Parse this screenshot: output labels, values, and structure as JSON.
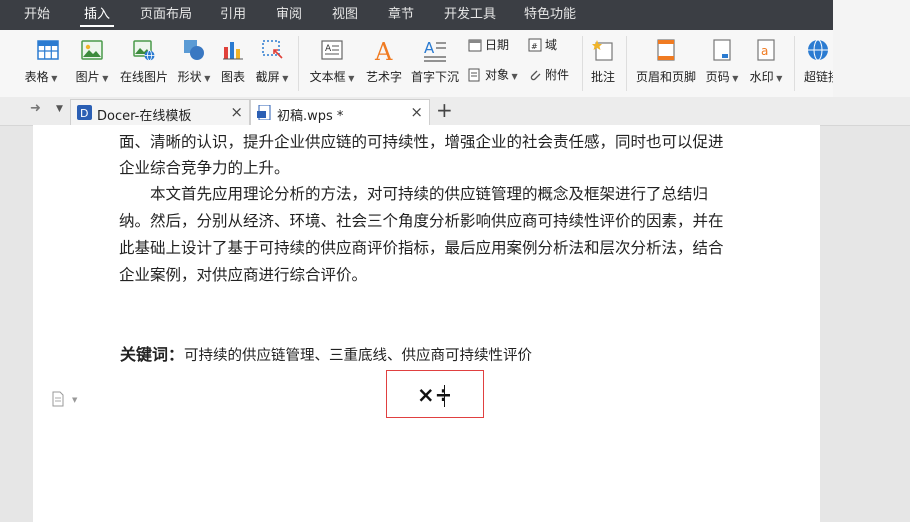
{
  "menu": {
    "tabs": [
      "开始",
      "插入",
      "页面布局",
      "引用",
      "审阅",
      "视图",
      "章节",
      "开发工具",
      "特色功能"
    ],
    "active_tab": "插入"
  },
  "ribbon": {
    "table": "表格",
    "picture": "图片",
    "online_picture": "在线图片",
    "shape": "形状",
    "chart": "图表",
    "screenshot": "截屏",
    "textbox": "文本框",
    "wordart": "艺术字",
    "dropcap": "首字下沉",
    "date": "日期",
    "object": "对象",
    "field": "域",
    "attachment": "附件",
    "comment": "批注",
    "header_footer": "页眉和页脚",
    "page_number": "页码",
    "watermark": "水印",
    "hyperlink": "超链接"
  },
  "doc_tabs": {
    "tab1": "Docer-在线模板",
    "tab2": "初稿.wps *",
    "close": "×",
    "add": "+"
  },
  "document": {
    "para1": [
      "面、清晰的认识，提升企业供应链的可持续性，增强企业的社会责任感，同时也可以促进",
      "企业综合竞争力的上升。"
    ],
    "para2": [
      "本文首先应用理论分析的方法，对可持续的供应链管理的概念及框架进行了总结归",
      "纳。然后，分别从经济、环境、社会三个角度分析影响供应商可持续性评价的因素，并在",
      "此基础上设计了基于可持续的供应商评价指标，最后应用案例分析法和层次分析法，结合",
      "企业案例，对供应商进行综合评价。"
    ],
    "keywords_label": "关键词：",
    "keywords": "可持续的供应链管理、三重底线、供应商可持续性评价",
    "math_symbols": "×÷"
  },
  "colors": {
    "menubar_bg": "#3b3e44",
    "selection_border": "#e04040",
    "page_bg": "#ffffff"
  }
}
